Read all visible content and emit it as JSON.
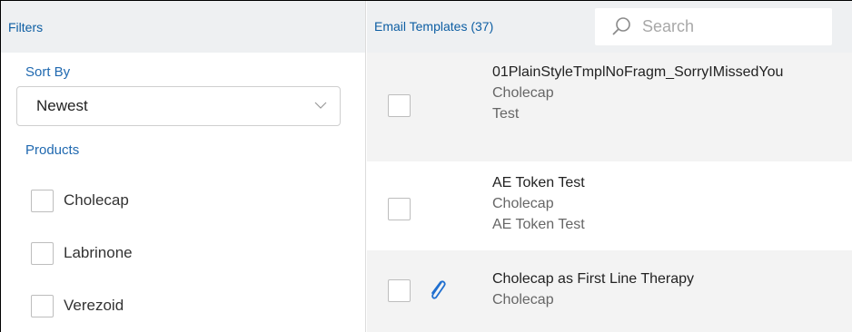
{
  "filters": {
    "header": "Filters",
    "sort_by_label": "Sort By",
    "sort_by_value": "Newest",
    "products_label": "Products",
    "products": [
      {
        "label": "Cholecap",
        "checked": false
      },
      {
        "label": "Labrinone",
        "checked": false
      },
      {
        "label": "Verezoid",
        "checked": false
      }
    ]
  },
  "templates": {
    "header": "Email Templates (37)",
    "search_placeholder": "Search",
    "items": [
      {
        "title": "01PlainStyleTmplNoFragm_SorryIMissedYou",
        "product": "Cholecap",
        "description": "Test",
        "has_attachment": false
      },
      {
        "title": "AE Token Test",
        "product": "Cholecap",
        "description": "AE Token Test",
        "has_attachment": false
      },
      {
        "title": "Cholecap as First Line Therapy",
        "product": "Cholecap",
        "description": "",
        "has_attachment": true
      }
    ]
  },
  "colors": {
    "header_bg": "#eef0f2",
    "accent_blue": "#0d5ea3",
    "row_alt_bg": "#f3f3f3"
  },
  "icons": {
    "sort_dropdown": "chevron-down-icon",
    "search": "search-icon",
    "attachment": "paperclip-icon"
  }
}
